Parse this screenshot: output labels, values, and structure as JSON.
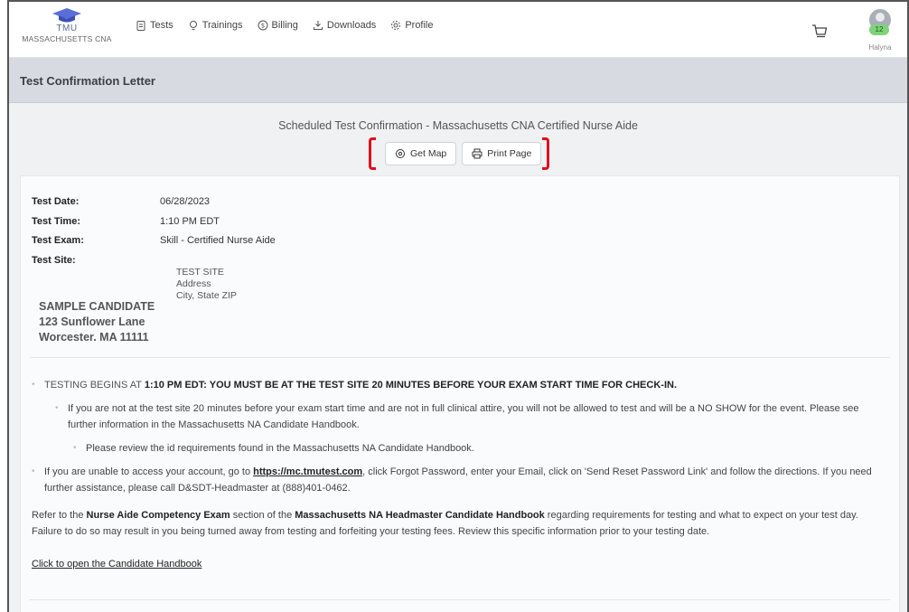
{
  "nav": {
    "brand": "TMU",
    "brand_sub": "MASSACHUSETTS CNA",
    "links": [
      {
        "label": "Tests",
        "icon": "clipboard-icon"
      },
      {
        "label": "Trainings",
        "icon": "lightbulb-icon"
      },
      {
        "label": "Billing",
        "icon": "dollar-circle-icon"
      },
      {
        "label": "Downloads",
        "icon": "download-icon"
      },
      {
        "label": "Profile",
        "icon": "gear-icon"
      }
    ],
    "cart_icon": "cart-icon",
    "user_badge": "12",
    "user_name": "Halyna"
  },
  "page": {
    "title": "Test Confirmation Letter",
    "confirm_title": "Scheduled Test Confirmation - Massachusetts CNA Certified Nurse Aide",
    "get_map_label": "Get Map",
    "print_label": "Print Page"
  },
  "details": {
    "test_date_label": "Test Date:",
    "test_date": "06/28/2023",
    "test_time_label": "Test Time:",
    "test_time": "1:10 PM EDT",
    "test_exam_label": "Test Exam:",
    "test_exam": "Skill - Certified Nurse Aide",
    "test_site_label": "Test Site:",
    "site_name": "TEST SITE",
    "site_address": "Address",
    "site_city": "City, State ZIP"
  },
  "candidate": {
    "name": "SAMPLE CANDIDATE",
    "street": "123 Sunflower Lane",
    "city": "Worcester. MA 11111"
  },
  "notes": {
    "b1_prefix": "TESTING BEGINS AT ",
    "b1_bold": "1:10 PM EDT:  YOU MUST BE AT THE TEST SITE 20 MINUTES BEFORE YOUR EXAM START TIME FOR CHECK-IN.",
    "b2": "If you are not at the test site 20 minutes before your exam start time and are not in full clinical attire, you will not be allowed to test and will be a NO SHOW for the event.  Please see further information in the Massachusetts NA Candidate Handbook.",
    "b3": "Please review the id requirements found in the Massachusetts NA Candidate Handbook.",
    "b4_pre": "If you are unable to access your account, go to ",
    "b4_link": "https://mc.tmutest.com",
    "b4_post": ", click Forgot Password, enter your Email, click on 'Send Reset Password Link' and follow the directions.  If you need further assistance, please call D&SDT-Headmaster at (888)401-0462.",
    "p1_a": "Refer to the ",
    "p1_b": "Nurse Aide Competency Exam",
    "p1_c": " section of the ",
    "p1_d": "Massachusetts NA Headmaster Candidate Handbook",
    "p1_e": " regarding requirements for testing and what to expect on your test day. Failure to do so may result in you being turned away from testing and forfeiting your testing fees. Review this specific information prior to your testing date.",
    "handbook_link": "Click to open the Candidate Handbook"
  }
}
